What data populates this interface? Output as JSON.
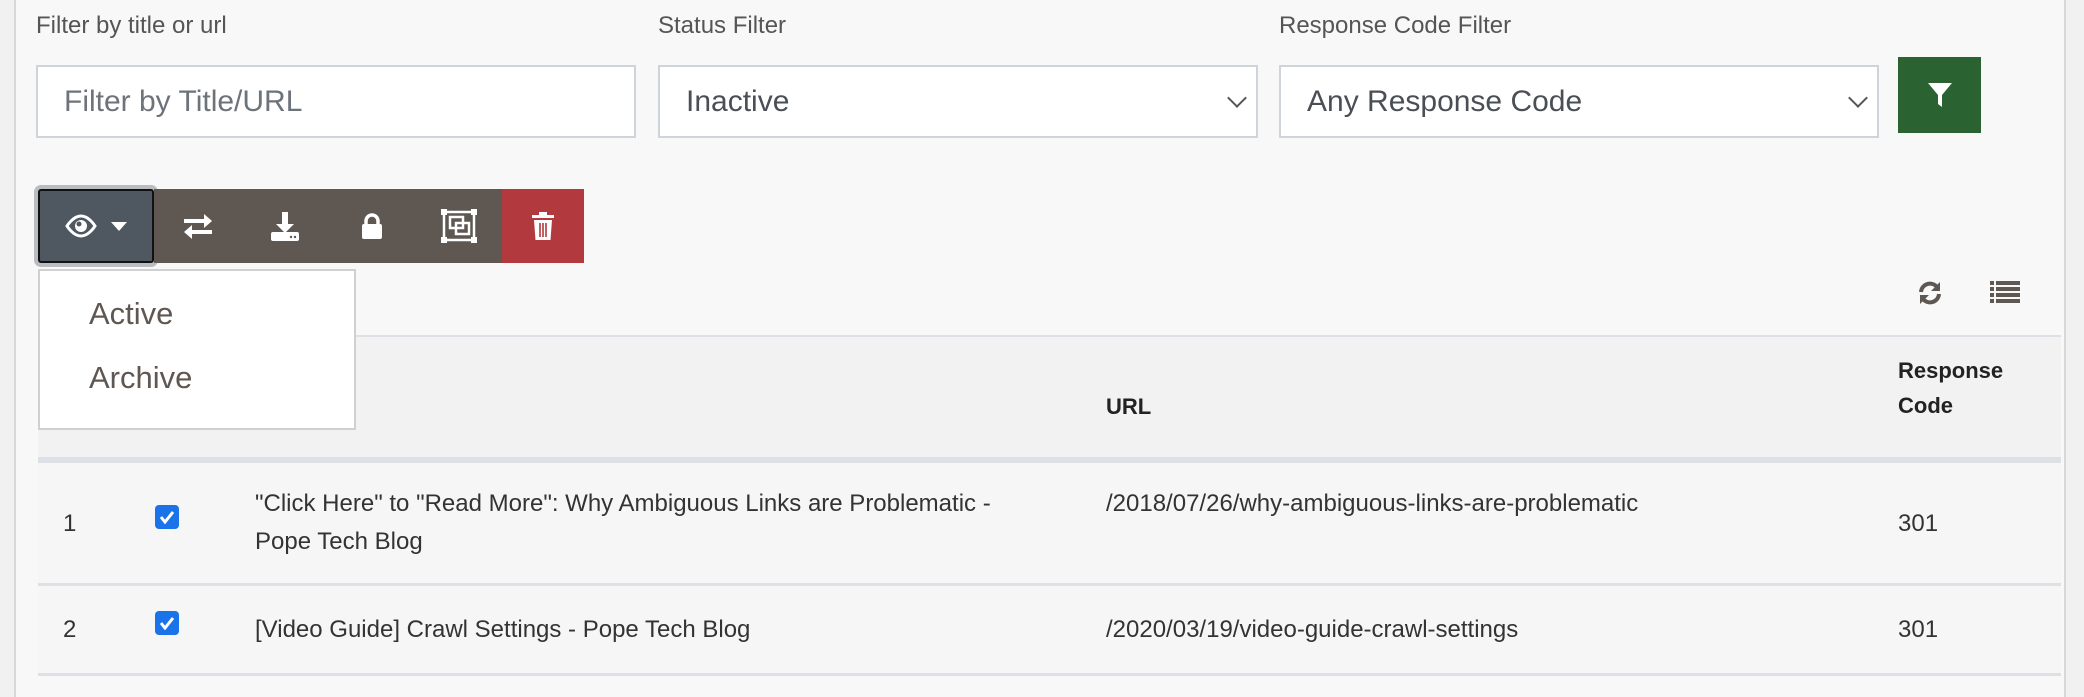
{
  "filters": {
    "title_label": "Filter by title or url",
    "title_placeholder": "Filter by Title/URL",
    "title_value": "",
    "status_label": "Status Filter",
    "status_value": "Inactive",
    "response_label": "Response Code Filter",
    "response_value": "Any Response Code",
    "apply_icon": "filter-icon"
  },
  "toolbar": {
    "buttons": [
      {
        "icon": "eye-icon",
        "caret": "caret-down-icon"
      },
      {
        "icon": "exchange-icon"
      },
      {
        "icon": "download-icon"
      },
      {
        "icon": "lock-icon"
      },
      {
        "icon": "object-group-icon"
      },
      {
        "icon": "trash-icon"
      }
    ],
    "dropdown": [
      "Active",
      "Archive"
    ]
  },
  "table_tools": {
    "refresh_icon": "refresh-icon",
    "columns_icon": "list-icon"
  },
  "table": {
    "headers": {
      "url": "URL",
      "response_line1": "Response",
      "response_line2": "Code"
    },
    "rows": [
      {
        "num": "1",
        "checked": true,
        "title_line1": "\"Click Here\" to \"Read More\": Why Ambiguous Links are Problematic -",
        "title_line2": "Pope Tech Blog",
        "url": "/2018/07/26/why-ambiguous-links-are-problematic",
        "code": "301"
      },
      {
        "num": "2",
        "checked": true,
        "title_line1": "[Video Guide] Crawl Settings - Pope Tech Blog",
        "title_line2": "",
        "url": "/2020/03/19/video-guide-crawl-settings",
        "code": "301"
      }
    ]
  },
  "colors": {
    "apply": "#2a6331",
    "toolbar": "#5f5751",
    "eye_active": "#4f5861",
    "delete": "#b23a3e",
    "checkbox": "#1a73e8"
  }
}
